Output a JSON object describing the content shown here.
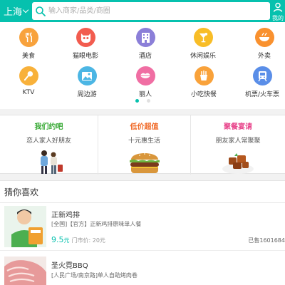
{
  "header": {
    "city": "上海",
    "search_placeholder": "输入商家/品类/商圈",
    "mine_label": "我的",
    "bg_color": "#06c1ae"
  },
  "categories": [
    {
      "label": "美食",
      "icon": "fork-knife-icon",
      "color": "#f8a23c"
    },
    {
      "label": "猫眼电影",
      "icon": "cat-face-icon",
      "color": "#f25c4f"
    },
    {
      "label": "酒店",
      "icon": "building-icon",
      "color": "#8b7fd8"
    },
    {
      "label": "休闲娱乐",
      "icon": "cocktail-icon",
      "color": "#f8bd27"
    },
    {
      "label": "外卖",
      "icon": "food-bowl-icon",
      "color": "#f9912f"
    },
    {
      "label": "KTV",
      "icon": "microphone-icon",
      "color": "#f8b13a"
    },
    {
      "label": "周边游",
      "icon": "landscape-icon",
      "color": "#4cb6e4"
    },
    {
      "label": "丽人",
      "icon": "lips-icon",
      "color": "#f06ea3"
    },
    {
      "label": "小吃快餐",
      "icon": "snack-icon",
      "color": "#f9a23a"
    },
    {
      "label": "机票/火车票",
      "icon": "train-icon",
      "color": "#5a8ee8"
    }
  ],
  "pager": {
    "pages": 2,
    "active": 0
  },
  "promos": [
    {
      "title": "我们约吧",
      "subtitle": "恋人家人好朋友",
      "color": "#35a832",
      "pic": "couple-photo"
    },
    {
      "title": "低价超值",
      "subtitle": "十元惠生活",
      "color": "#f06a28",
      "pic": "burger-photo"
    },
    {
      "title": "聚餐宴请",
      "subtitle": "朋友家人常聚聚",
      "color": "#e8468c",
      "pic": "braised-dish-photo"
    }
  ],
  "guess": {
    "title": "猜你喜欢",
    "deals": [
      {
        "name": "正新鸡排",
        "desc": "[全国]【官方】正新鸡排原味单人餐",
        "price": "9.5",
        "price_unit": "元",
        "orig": "门市价: 20元",
        "sold": "已售1601684",
        "pic": "chicken-cutlet-photo"
      },
      {
        "name": "圣火霓BBQ",
        "desc": "[人民广场/南京路]单人自助烤肉卷",
        "pic": "bbq-meat-photo"
      }
    ]
  }
}
